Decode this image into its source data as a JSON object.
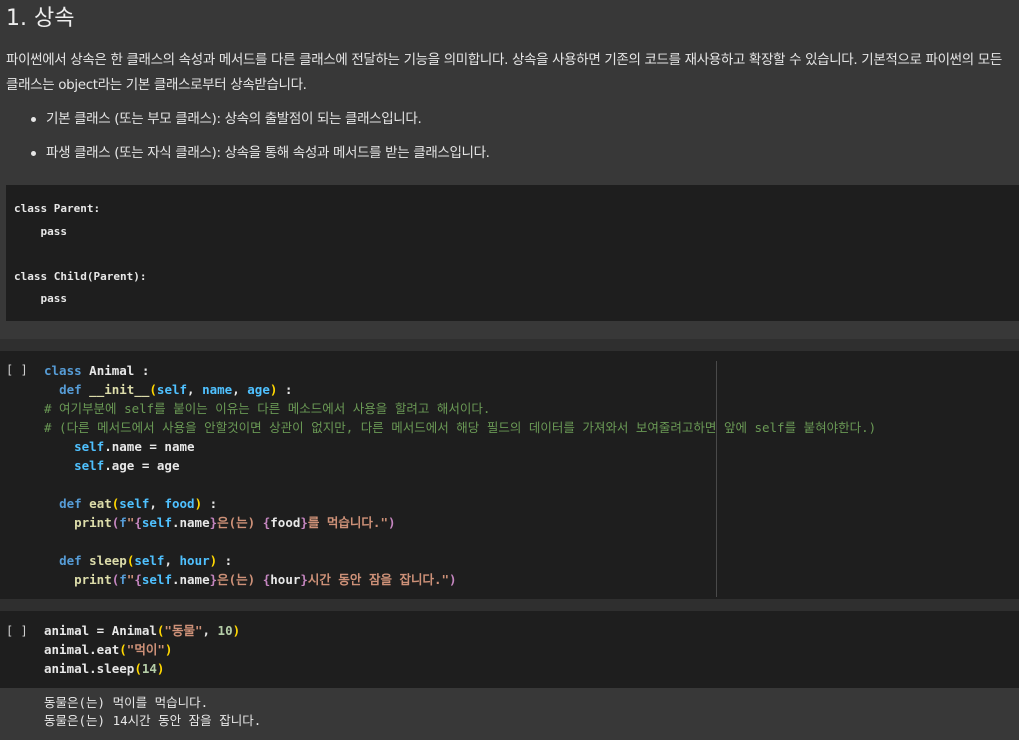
{
  "heading": "1. 상속",
  "intro": "파이썬에서 상속은 한 클래스의 속성과 메서드를 다른 클래스에 전달하는 기능을 의미합니다. 상속을 사용하면 기존의 코드를 재사용하고 확장할 수 있습니다. 기본적으로 파이썬의 모든 클래스는 object라는 기본 클래스로부터 상속받습니다.",
  "bullets": [
    "기본 클래스 (또는 부모 클래스): 상속의 출발점이 되는 클래스입니다.",
    "파생 클래스 (또는 자식 클래스): 상속을 통해 속성과 메서드를 받는 클래스입니다."
  ],
  "md_code": "class Parent:\n    pass\n\nclass Child(Parent):\n    pass",
  "cells": [
    {
      "gutter": "[ ]",
      "lines": [
        "class Animal :",
        "  def __init__(self, name, age) :",
        "# 여기부분에 self를 붙이는 이유는 다른 메소드에서 사용을 할려고 해서이다.",
        "# (다른 메서드에서 사용을 안할것이면 상관이 없지만, 다른 메서드에서 해당 필드의 데이터를 가져와서 보여줄려고하면 앞에 self를 붙혀야한다.)",
        "    self.name = name",
        "    self.age = age",
        "",
        "  def eat(self, food) :",
        "    print(f\"{self.name}은(는) {food}를 먹습니다.\")",
        "",
        "  def sleep(self, hour) :",
        "    print(f\"{self.name}은(는) {hour}시간 동안 잠을 잡니다.\")"
      ]
    },
    {
      "gutter": "[ ]",
      "lines": [
        "animal = Animal(\"동물\", 10)",
        "animal.eat(\"먹이\")",
        "animal.sleep(14)"
      ],
      "output": [
        "동물은(는) 먹이를 먹습니다.",
        "동물은(는) 14시간 동안 잠을 잡니다."
      ]
    }
  ]
}
